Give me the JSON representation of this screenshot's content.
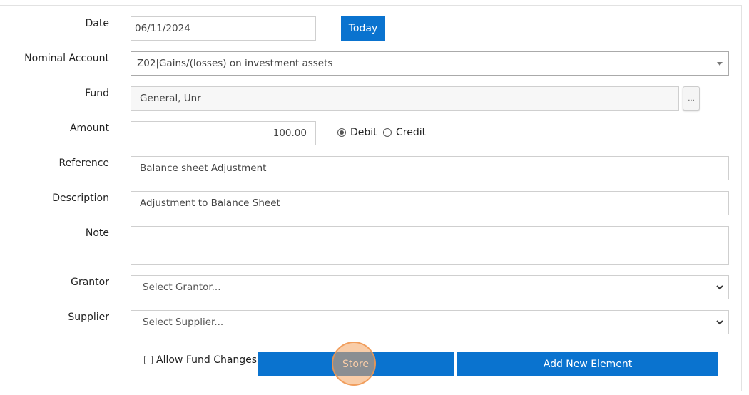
{
  "form": {
    "date": {
      "label": "Date",
      "value": "06/11/2024",
      "today_label": "Today"
    },
    "nominal_account": {
      "label": "Nominal Account",
      "value": "Z02|Gains/(losses) on investment assets"
    },
    "fund": {
      "label": "Fund",
      "value": "General, Unr",
      "lookup_label": "..."
    },
    "amount": {
      "label": "Amount",
      "value": "100.00",
      "debit_label": "Debit",
      "credit_label": "Credit",
      "selected": "Debit"
    },
    "reference": {
      "label": "Reference",
      "value": "Balance sheet Adjustment"
    },
    "description": {
      "label": "Description",
      "value": "Adjustment to Balance Sheet"
    },
    "note": {
      "label": "Note",
      "value": ""
    },
    "grantor": {
      "label": "Grantor",
      "placeholder": "Select Grantor..."
    },
    "supplier": {
      "label": "Supplier",
      "placeholder": "Select Supplier..."
    },
    "allow_fund_changes": {
      "label": "Allow Fund Changes",
      "checked": false
    },
    "actions": {
      "store_label": "Store",
      "add_new_label": "Add New Element"
    }
  },
  "colors": {
    "accent": "#0a73cf",
    "click_highlight": "#f4a460"
  }
}
